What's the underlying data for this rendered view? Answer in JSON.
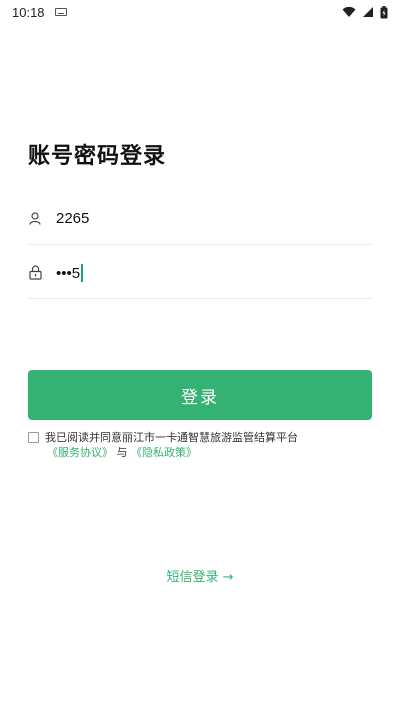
{
  "status_bar": {
    "time": "10:18"
  },
  "login": {
    "title": "账号密码登录",
    "account_value": "2265",
    "password_value": "•••5",
    "login_button": "登录"
  },
  "agreement": {
    "text": "我已阅读并同意丽江市一卡通智慧旅游监管结算平台",
    "service_link": "《服务协议》",
    "conjunction": "与",
    "privacy_link": "《隐私政策》"
  },
  "sms_login": "短信登录 →",
  "colors": {
    "accent": "#34b274"
  }
}
